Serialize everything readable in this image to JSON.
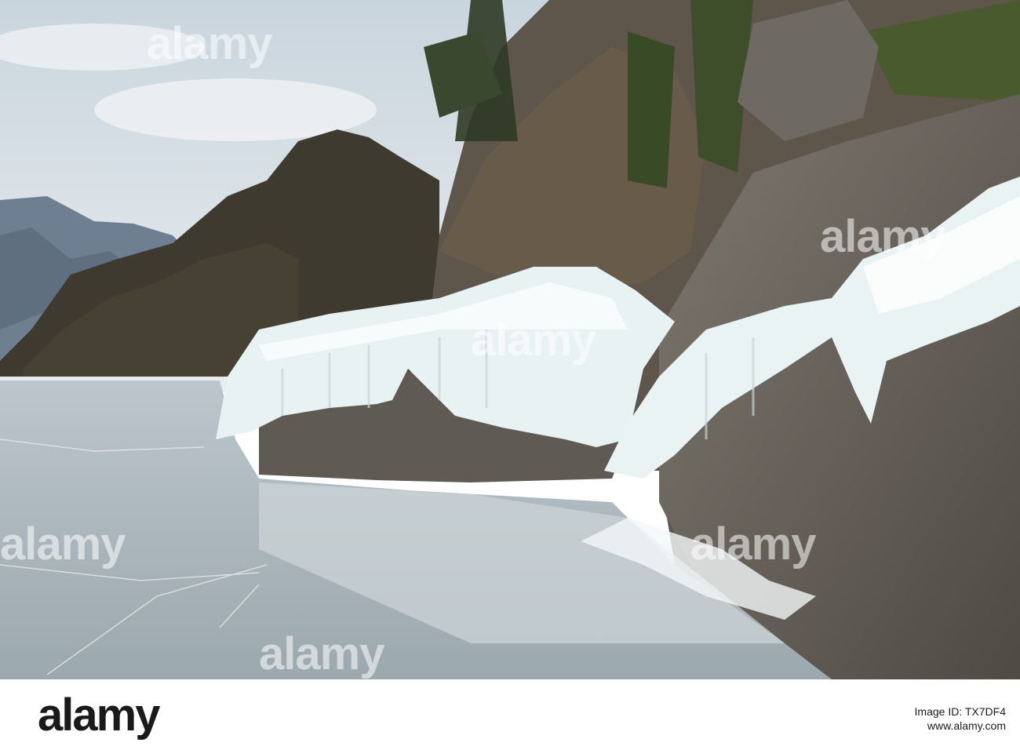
{
  "image": {
    "alt_semantics": "frozen-lake-shore-with-ice-covered-rocks"
  },
  "watermark": {
    "text": "alamy"
  },
  "footer": {
    "brand": "alamy",
    "image_id_label": "Image ID: TX7DF4",
    "domain": "www.alamy.com"
  },
  "colors": {
    "sky": "#d9e1e6",
    "ice": "#e8f2f3",
    "rock": "#6d6760",
    "forest": "#3f3a30"
  }
}
